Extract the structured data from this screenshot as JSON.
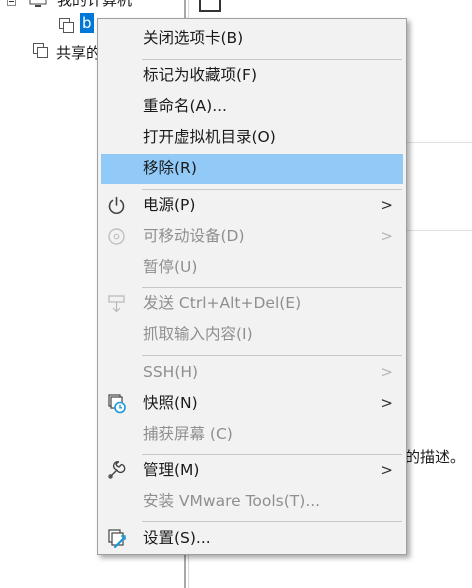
{
  "tree": {
    "root_label": "我的计算机",
    "selected_vm_label": "b",
    "shared_label": "共享的"
  },
  "right_panel": {
    "description_fragment": "的描述。"
  },
  "menu": {
    "close_tab": "关闭选项卡(B)",
    "mark_favorite": "标记为收藏项(F)",
    "rename": "重命名(A)...",
    "open_vm_directory": "打开虚拟机目录(O)",
    "remove": "移除(R)",
    "power": "电源(P)",
    "removable_devices": "可移动设备(D)",
    "pause": "暂停(U)",
    "send_ctrl_alt_del": "发送 Ctrl+Alt+Del(E)",
    "grab_input": "抓取输入内容(I)",
    "ssh": "SSH(H)",
    "snapshot": "快照(N)",
    "capture_screen": "捕获屏幕 (C)",
    "manage": "管理(M)",
    "install_vmware_tools": "安装 VMware Tools(T)...",
    "settings": "设置(S)...",
    "submenu_arrow": ">"
  },
  "colors": {
    "highlight": "#91c9f7",
    "selection": "#0078d7",
    "disabled_text": "#8f8f8f",
    "menu_bg": "#f2f2f2"
  }
}
